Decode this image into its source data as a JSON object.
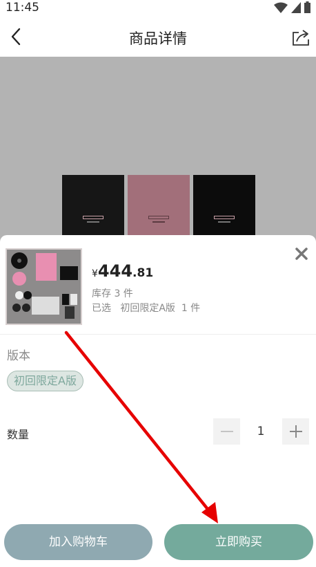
{
  "status_bar": {
    "time": "11:45"
  },
  "nav": {
    "title": "商品详情"
  },
  "sheet": {
    "price_currency": "¥",
    "price_integer": "444",
    "price_decimal": ".81",
    "stock_text": "库存 3 件",
    "selected_text": "已选   初回限定A版  1 件",
    "version_label": "版本",
    "version_option": "初回限定A版",
    "quantity_label": "数量",
    "quantity_value": "1",
    "add_to_cart_label": "加入购物车",
    "buy_now_label": "立即购买"
  },
  "colors": {
    "accent_teal": "#74aa9c",
    "cart_button": "#8fa9b1",
    "annotation_arrow": "#e60000"
  }
}
